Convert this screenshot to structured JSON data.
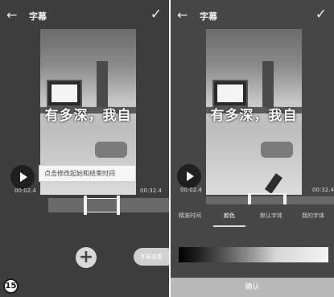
{
  "step_number": "15",
  "panel_left": {
    "back_label": "←",
    "title": "字幕",
    "confirm_label": "✓",
    "video_subtitle": "有多深，我自",
    "edit_hint": "点击修改起始和结束时间",
    "time_start": "00:02.4",
    "time_end": "00:32.4",
    "add_label": "+",
    "subtitle_settings_label": "字幕设置"
  },
  "panel_right": {
    "back_label": "←",
    "title": "字幕",
    "confirm_label": "✓",
    "video_subtitle": "有多深，我自",
    "time_start": "00:02.4",
    "time_end": "00:32.4",
    "tabs": [
      {
        "label": "精准时间",
        "active": false
      },
      {
        "label": "颜色",
        "active": true
      },
      {
        "label": "默认字体",
        "active": false
      },
      {
        "label": "我的字体",
        "active": false
      }
    ],
    "confirm_button_label": "确认"
  },
  "colors": {
    "panel_bg": "#3d3d3d",
    "accent_light": "#f2f2f2",
    "confirm_bar": "#b8b8b8"
  },
  "icons": [
    "back-arrow-icon",
    "checkmark-icon",
    "play-icon",
    "plus-icon"
  ]
}
